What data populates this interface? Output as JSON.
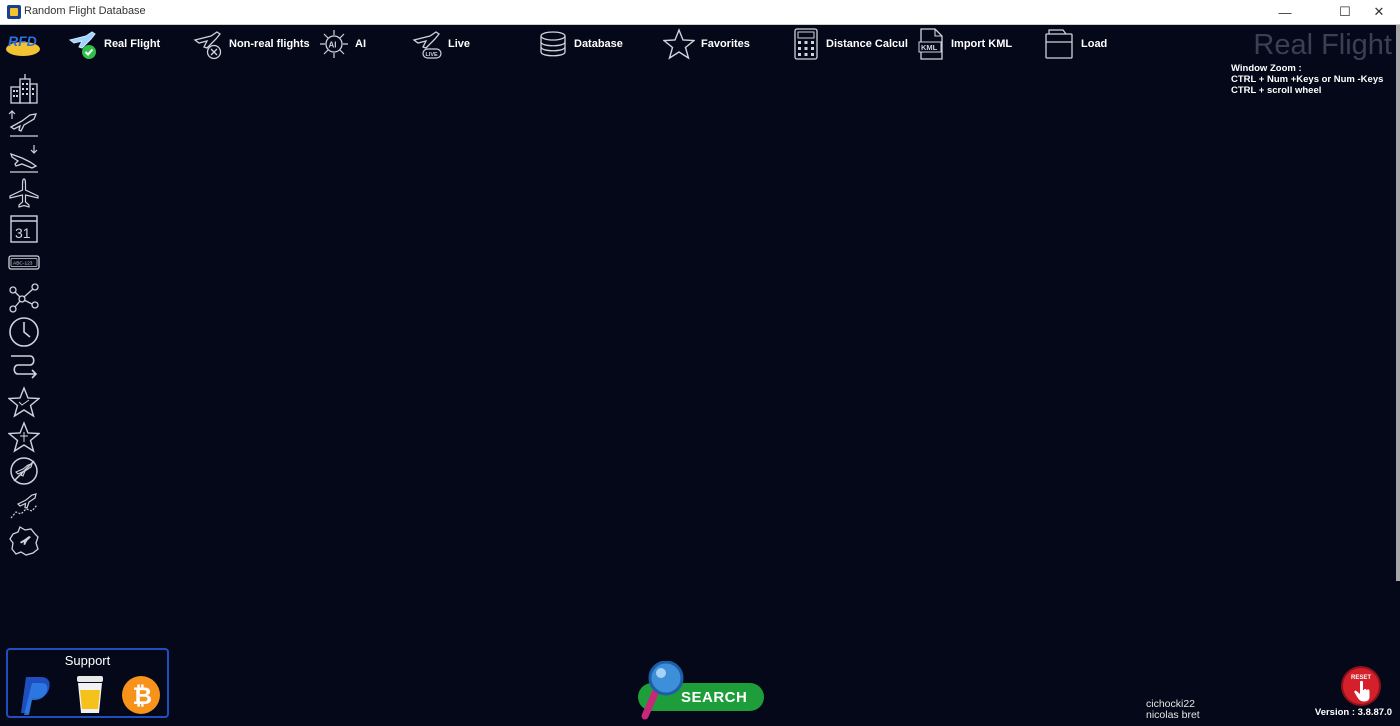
{
  "window": {
    "title": "Random Flight Database",
    "minimize": "—",
    "maximize": "☐",
    "close": "✕"
  },
  "logo": {
    "text": "RFD"
  },
  "toolbar": {
    "items": [
      {
        "label": "Real Flight",
        "icon": "plane-check-icon"
      },
      {
        "label": "Non-real flights",
        "icon": "plane-cross-icon"
      },
      {
        "label": "AI",
        "icon": "ai-chip-icon"
      },
      {
        "label": "Live",
        "icon": "plane-live-icon"
      },
      {
        "label": "Database",
        "icon": "database-icon"
      },
      {
        "label": "Favorites",
        "icon": "star-icon"
      },
      {
        "label": "Distance Calcul",
        "icon": "calculator-icon"
      },
      {
        "label": "Import KML",
        "icon": "kml-file-icon"
      },
      {
        "label": "Load",
        "icon": "folder-icon"
      }
    ]
  },
  "mode_title": "Real Flight",
  "zoom_help": {
    "line1": "Window Zoom :",
    "line2": "CTRL + Num +Keys or Num -Keys",
    "line3": "CTRL + scroll wheel"
  },
  "sidebar": {
    "icons": [
      "city-icon",
      "departure-icon",
      "arrival-icon",
      "airplane-icon",
      "calendar-icon",
      "registration-icon",
      "route-network-icon",
      "clock-icon",
      "route-path-icon",
      "star-outline-icon",
      "star-badge-icon",
      "no-fly-icon",
      "plane-map-icon",
      "country-map-icon"
    ],
    "calendar_day": "31",
    "registration": "ABC-123"
  },
  "support": {
    "title": "Support",
    "items": [
      "paypal-icon",
      "coffee-icon",
      "bitcoin-icon"
    ]
  },
  "search": {
    "label": "SEARCH"
  },
  "reset": {
    "label": "RESET"
  },
  "credits": {
    "line1": "cichocki22",
    "line2": "nicolas bret"
  },
  "version": "Version : 3.8.87.0",
  "colors": {
    "background": "#050818",
    "accent_green": "#1e9e3a",
    "reset_red": "#d3202a",
    "support_border": "#1f4fbf",
    "bitcoin": "#f7931a",
    "paypal": "#1f4fbf"
  }
}
